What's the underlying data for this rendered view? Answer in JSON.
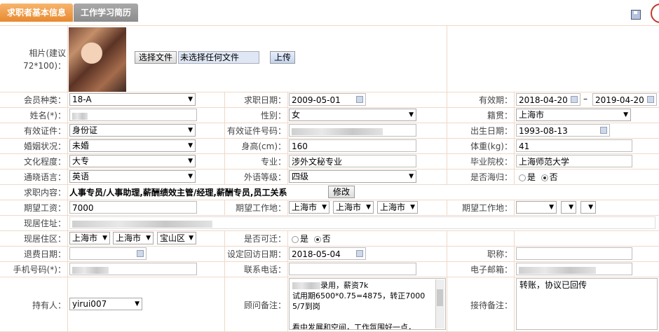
{
  "tabs": [
    "求职者基本信息",
    "工作学习简历"
  ],
  "photo": {
    "label": "相片(建议72*100)：",
    "file_button": "选择文件",
    "file_status": "未选择任何文件",
    "upload_button": "上传"
  },
  "member_type": {
    "label": "会员种类：",
    "value": "18-A"
  },
  "job_date": {
    "label": "求职日期：",
    "value": "2009-05-01"
  },
  "valid_period": {
    "label": "有效期：",
    "from": "2018-04-20",
    "sep": "–",
    "to": "2019-04-20"
  },
  "name": {
    "label": "姓名(*)："
  },
  "gender": {
    "label": "性别：",
    "value": "女"
  },
  "native_place": {
    "label": "籍贯：",
    "value": "上海市"
  },
  "id_type": {
    "label": "有效证件：",
    "value": "身份证"
  },
  "id_number": {
    "label": "有效证件号码："
  },
  "birth_date": {
    "label": "出生日期：",
    "value": "1993-08-13"
  },
  "marital": {
    "label": "婚姻状况：",
    "value": "未婚"
  },
  "height": {
    "label": "身高(cm)：",
    "value": "160"
  },
  "weight": {
    "label": "体重(kg)：",
    "value": "41"
  },
  "education": {
    "label": "文化程度：",
    "value": "大专"
  },
  "major": {
    "label": "专业：",
    "value": "涉外文秘专业"
  },
  "school": {
    "label": "毕业院校：",
    "value": "上海师范大学"
  },
  "language": {
    "label": "通晓语言：",
    "value": "英语"
  },
  "language_level": {
    "label": "外语等级：",
    "value": "四级"
  },
  "overseas": {
    "label": "是否海归：",
    "yes": "是",
    "no": "否"
  },
  "job_content": {
    "label": "求职内容：",
    "value": "人事专员/人事助理,薪酬绩效主管/经理,薪酬专员,员工关系",
    "modify_button": "修改"
  },
  "expected_salary": {
    "label": "期望工资：",
    "value": "7000"
  },
  "expected_location": {
    "label": "期望工作地：",
    "v1": "上海市",
    "v2": "上海市",
    "v3": "上海市"
  },
  "expected_location2": {
    "label": "期望工作地："
  },
  "current_address": {
    "label": "现居住址："
  },
  "current_area": {
    "label": "现居住区：",
    "v1": "上海市",
    "v2": "上海市",
    "v3": "宝山区"
  },
  "relocate": {
    "label": "是否可迁：",
    "yes": "是",
    "no": "否"
  },
  "refund_date": {
    "label": "退费日期："
  },
  "revisit_date": {
    "label": "设定回访日期：",
    "value": "2018-05-04"
  },
  "title": {
    "label": "职称："
  },
  "mobile": {
    "label": "手机号码(*)："
  },
  "phone": {
    "label": "联系电话："
  },
  "email": {
    "label": "电子邮箱："
  },
  "holder": {
    "label": "持有人：",
    "value": "yirui007"
  },
  "consultant_note": {
    "label": "顾问备注：",
    "line1": "录用，薪资7k",
    "line2": "试用期6500*0.75=4875，转正7000",
    "line3": "5/7到岗",
    "line4": "看中发展和空间，工作氛围好一点，"
  },
  "reception_note": {
    "label": "接待备注：",
    "value": "转账，协议已回传"
  }
}
